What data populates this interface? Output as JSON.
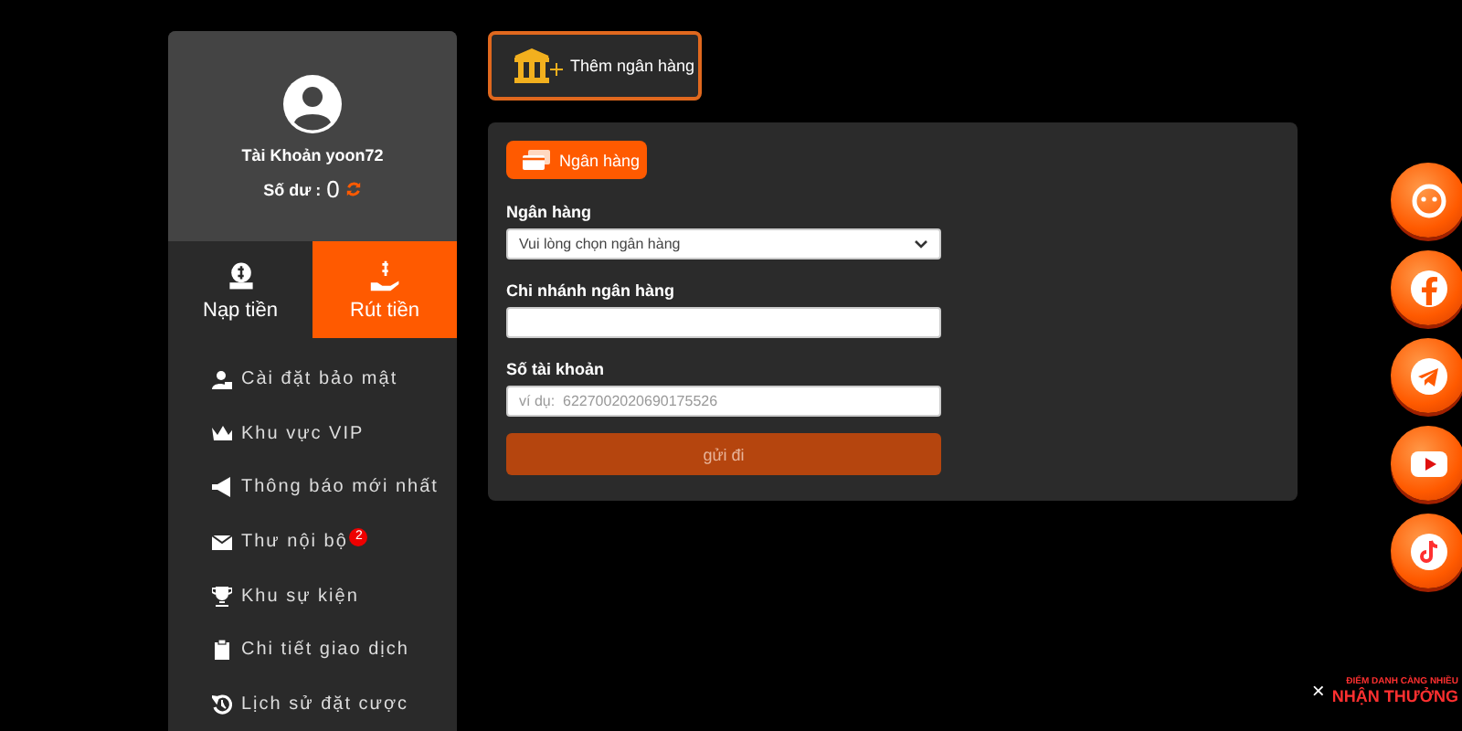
{
  "profile": {
    "account": "Tài Khoản yoon72",
    "balance_label": "Số dư :",
    "balance": "0"
  },
  "tabs": [
    {
      "label": "Nạp tiền",
      "kind": "deposit",
      "selected": false
    },
    {
      "label": "Rút tiền",
      "kind": "withdraw",
      "selected": true
    }
  ],
  "menu": [
    {
      "label": "Cài đặt bảo mật",
      "kind": "security"
    },
    {
      "label": "Khu vực VIP",
      "kind": "vip"
    },
    {
      "label": "Thông báo mới nhất",
      "kind": "announce"
    },
    {
      "label": "Thư nội bộ",
      "kind": "mail",
      "badge": "2"
    },
    {
      "label": "Khu sự kiện",
      "kind": "trophy"
    },
    {
      "label": "Chi tiết giao dịch",
      "kind": "clipboard"
    },
    {
      "label": "Lịch sử đặt cược",
      "kind": "history"
    }
  ],
  "add_bank_button": "Thêm ngân hàng",
  "form": {
    "tab": {
      "label": "Ngân hàng",
      "selected": true
    },
    "fields": [
      {
        "label": "Ngân hàng",
        "kind": "select",
        "value": "Vui lòng chọn ngân hàng"
      },
      {
        "label": "Chi nhánh ngân hàng",
        "kind": "text"
      },
      {
        "label": "Số tài khoản",
        "kind": "text",
        "placeholder": "ví dụ:  6227002020690175526"
      }
    ],
    "submit": "gửi đi"
  },
  "social": [
    {
      "kind": "chat"
    },
    {
      "kind": "facebook"
    },
    {
      "kind": "telegram"
    },
    {
      "kind": "youtube"
    },
    {
      "kind": "tiktok"
    }
  ],
  "promo": {
    "close": "×",
    "line_1": "ĐIỂM DANH CÀNG NHIỀU",
    "line_2": "NHẬN THƯỞNG"
  }
}
